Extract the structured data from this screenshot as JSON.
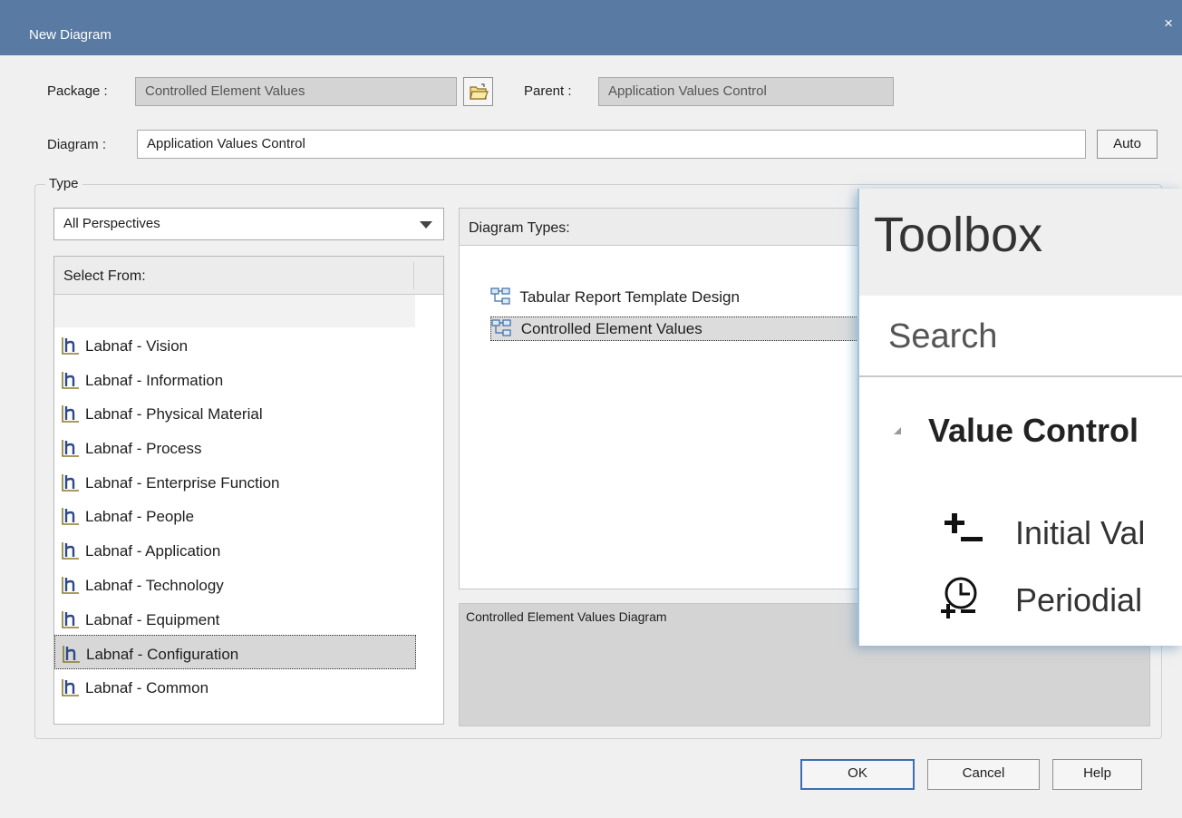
{
  "window": {
    "title": "New Diagram",
    "close_glyph": "×"
  },
  "package": {
    "label": "Package :",
    "value": "Controlled Element Values",
    "browse_icon": "folder-open-icon"
  },
  "parent": {
    "label": "Parent :",
    "value": "Application Values Control"
  },
  "diagram": {
    "label": "Diagram :",
    "value": "Application Values Control",
    "auto_label": "Auto"
  },
  "type_group": {
    "label": "Type",
    "perspective": "All Perspectives",
    "select_from_header": "Select From:",
    "items": [
      "Labnaf - Vision",
      "Labnaf - Information",
      "Labnaf - Physical Material",
      "Labnaf - Process",
      "Labnaf - Enterprise Function",
      "Labnaf - People",
      "Labnaf - Application",
      "Labnaf - Technology",
      "Labnaf - Equipment",
      "Labnaf - Configuration",
      "Labnaf - Common"
    ],
    "selected_index": 9,
    "diagram_types_header": "Diagram Types:",
    "diagram_types": [
      "Tabular Report Template Design",
      "Controlled Element Values"
    ],
    "selected_type_index": 1,
    "description": "Controlled Element Values Diagram"
  },
  "buttons": {
    "ok": "OK",
    "cancel": "Cancel",
    "help": "Help"
  },
  "toolbox": {
    "title": "Toolbox",
    "search": "Search",
    "group": "Value Control",
    "items": [
      {
        "label": "Initial Val",
        "icon": "plus-minus-icon"
      },
      {
        "label": "Periodial",
        "icon": "clock-plus-minus-icon"
      }
    ]
  },
  "colors": {
    "titlebar": "#587aa3",
    "dialog_bg": "#f0f0f0",
    "readonly_field": "#d4d4d4",
    "selection": "#d7d7d7",
    "toolbox_glow": "#9ec5dc"
  }
}
